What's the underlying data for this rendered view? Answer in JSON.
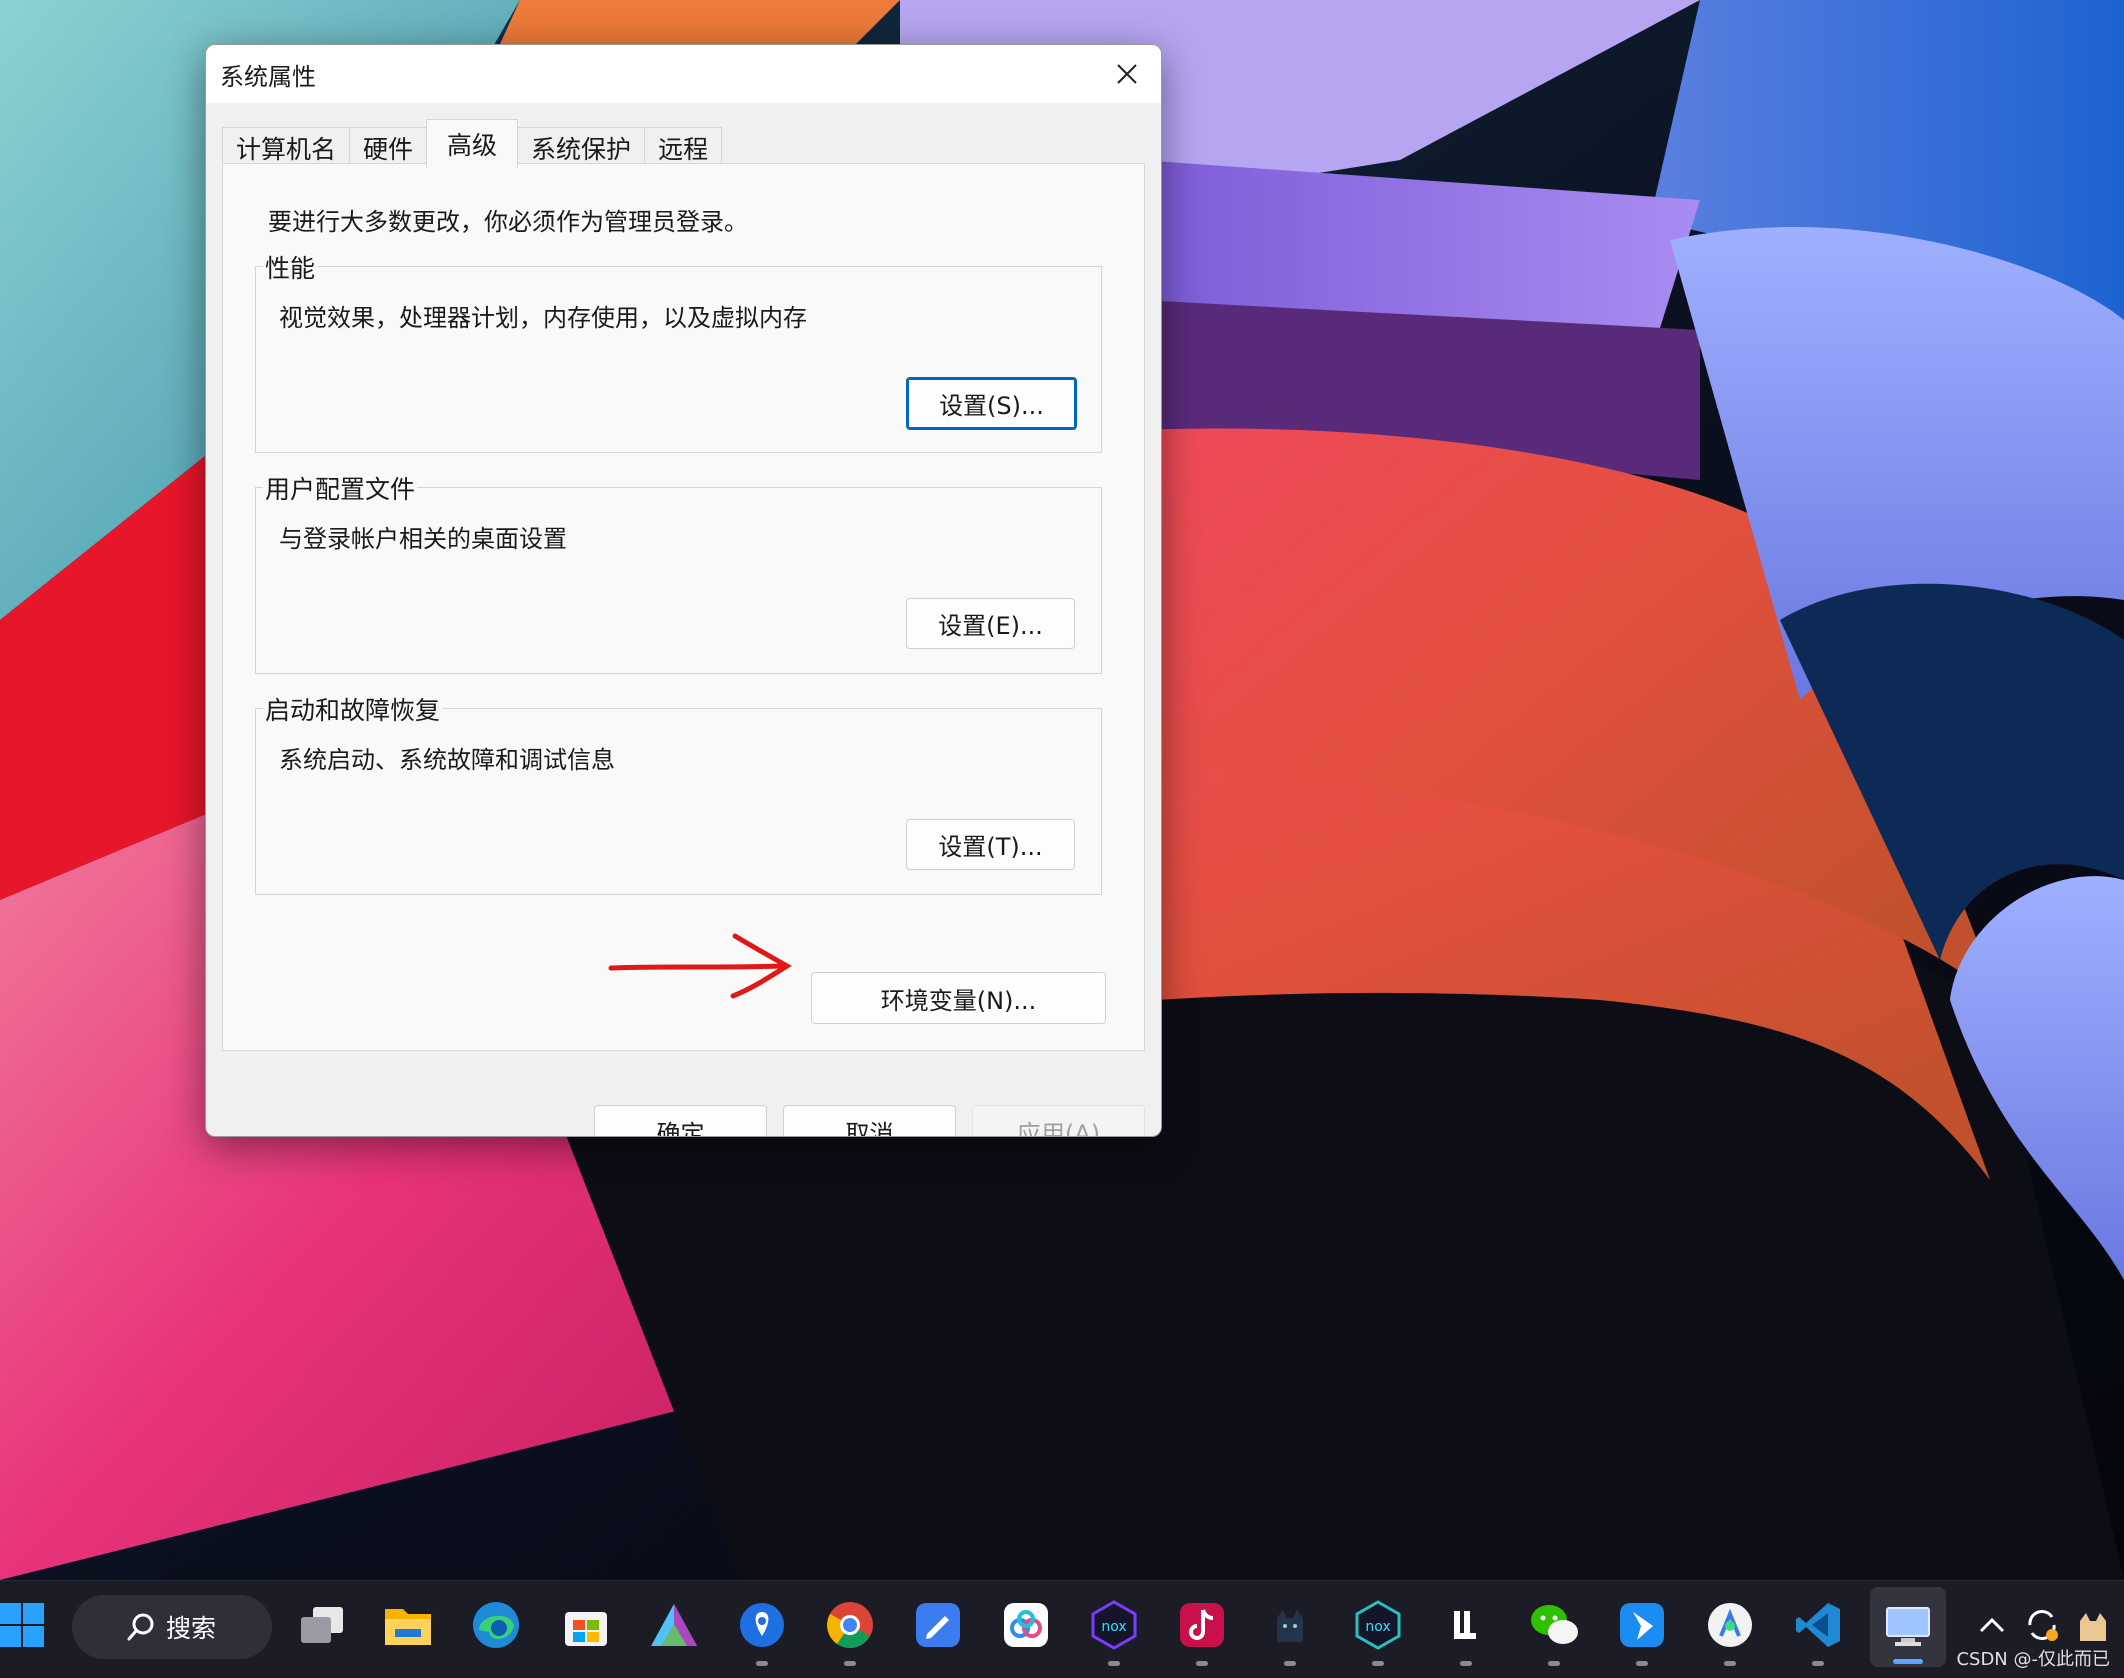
{
  "colors": {
    "accent": "#0067c0",
    "annotation": "#e01818",
    "taskbar": "#1c1c26"
  },
  "dialog": {
    "title": "系统属性",
    "tabs": [
      "计算机名",
      "硬件",
      "高级",
      "系统保护",
      "远程"
    ],
    "active_tab": "高级",
    "notice": "要进行大多数更改，你必须作为管理员登录。",
    "groups": [
      {
        "title": "性能",
        "description": "视觉效果，处理器计划，内存使用，以及虚拟内存",
        "button": "设置(S)..."
      },
      {
        "title": "用户配置文件",
        "description": "与登录帐户相关的桌面设置",
        "button": "设置(E)..."
      },
      {
        "title": "启动和故障恢复",
        "description": "系统启动、系统故障和调试信息",
        "button": "设置(T)..."
      }
    ],
    "env_button": "环境变量(N)...",
    "ok": "确定",
    "cancel": "取消",
    "apply": "应用(A)"
  },
  "taskbar": {
    "search_label": "搜索",
    "apps": [
      "start-icon",
      "task-view-icon",
      "file-explorer-icon",
      "edge-icon",
      "microsoft-store-icon",
      "app-a-icon",
      "maps-pin-icon",
      "chrome-icon",
      "notes-pen-icon",
      "baidu-netdisk-icon",
      "nox-player-icon",
      "tiktok-icon",
      "cat-app-icon",
      "nox-player-2-icon",
      "ll-app-icon",
      "wechat-icon",
      "feishu-icon",
      "android-studio-icon",
      "vscode-icon",
      "remote-desktop-icon"
    ],
    "watermark": "CSDN @-仅此而已"
  }
}
